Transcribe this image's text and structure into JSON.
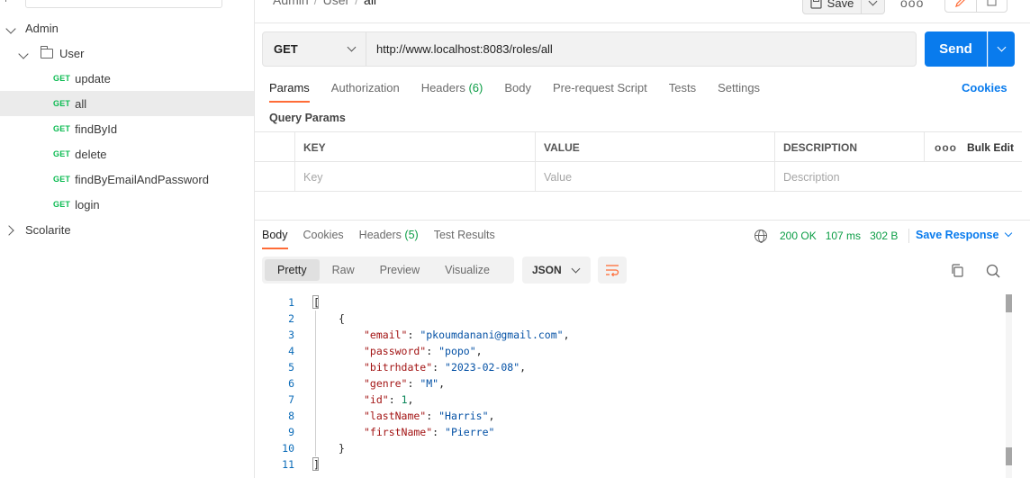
{
  "sidebar": {
    "items": [
      {
        "label": "Admin"
      },
      {
        "label": "User"
      },
      {
        "method": "GET",
        "label": "update"
      },
      {
        "method": "GET",
        "label": "all"
      },
      {
        "method": "GET",
        "label": "findById"
      },
      {
        "method": "GET",
        "label": "delete"
      },
      {
        "method": "GET",
        "label": "findByEmailAndPassword"
      },
      {
        "method": "GET",
        "label": "login"
      },
      {
        "label": "Scolarite"
      }
    ]
  },
  "header": {
    "breadcrumb": [
      "Admin",
      "User",
      "all"
    ],
    "save_label": "Save",
    "more": "ooo"
  },
  "request": {
    "method": "GET",
    "url": "http://www.localhost:8083/roles/all",
    "send_label": "Send"
  },
  "request_tabs": [
    {
      "label": "Params"
    },
    {
      "label": "Authorization"
    },
    {
      "label": "Headers ",
      "count": "(6)"
    },
    {
      "label": "Body"
    },
    {
      "label": "Pre-request Script"
    },
    {
      "label": "Tests"
    },
    {
      "label": "Settings"
    }
  ],
  "cookies_label": "Cookies",
  "query_params": {
    "title": "Query Params",
    "headers": [
      "KEY",
      "VALUE",
      "DESCRIPTION"
    ],
    "more": "ooo",
    "bulk_edit": "Bulk Edit",
    "placeholders": [
      "Key",
      "Value",
      "Description"
    ]
  },
  "response_tabs": [
    {
      "label": "Body"
    },
    {
      "label": "Cookies"
    },
    {
      "label": "Headers ",
      "count": "(5)"
    },
    {
      "label": "Test Results"
    }
  ],
  "response_meta": {
    "status": "200 OK",
    "time": "107 ms",
    "size": "302 B",
    "save_response": "Save Response"
  },
  "view_modes": [
    "Pretty",
    "Raw",
    "Preview",
    "Visualize"
  ],
  "format": "JSON",
  "code_lines": [
    "1",
    "2",
    "3",
    "4",
    "5",
    "6",
    "7",
    "8",
    "9",
    "10",
    "11"
  ],
  "json_body": {
    "open": "[",
    "obj_open": "{",
    "email_key": "\"email\"",
    "email_val": "\"pkoumdanani@gmail.com\"",
    "password_key": "\"password\"",
    "password_val": "\"popo\"",
    "bitrhdate_key": "\"bitrhdate\"",
    "bitrhdate_val": "\"2023-02-08\"",
    "genre_key": "\"genre\"",
    "genre_val": "\"M\"",
    "id_key": "\"id\"",
    "id_val": "1",
    "lastName_key": "\"lastName\"",
    "lastName_val": "\"Harris\"",
    "firstName_key": "\"firstName\"",
    "firstName_val": "\"Pierre\"",
    "obj_close": "}",
    "close": "]"
  },
  "colors": {
    "accent": "#097bed",
    "tab_underline": "#ff6c37",
    "get_method": "#0cbb52",
    "status_ok": "#0b9d45"
  }
}
